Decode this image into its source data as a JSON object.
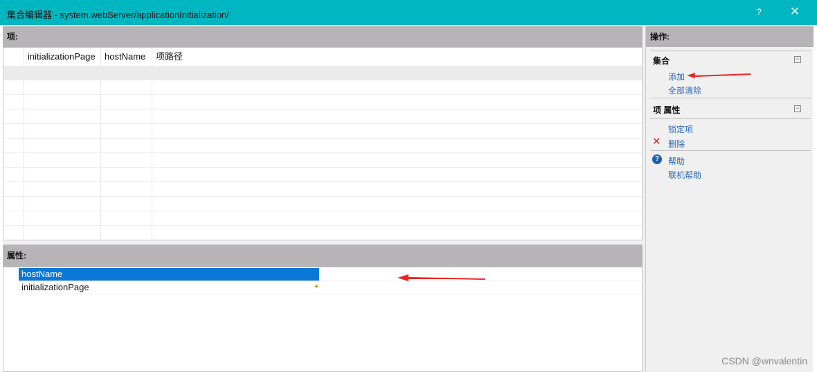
{
  "window": {
    "title": "集合编辑器 - system.webServer/applicationInitialization/",
    "help_label": "?",
    "close_label": "✕"
  },
  "items_panel": {
    "header": "项:",
    "columns": [
      "initializationPage",
      "hostName",
      "项路径"
    ]
  },
  "properties_panel": {
    "header": "属性:",
    "rows": [
      {
        "name": "hostName",
        "selected": true
      },
      {
        "name": "initializationPage",
        "selected": false,
        "key_icon": "key-icon"
      }
    ]
  },
  "actions_pane": {
    "header": "操作:",
    "collection": {
      "title": "集合",
      "collapse": "⊟",
      "links": [
        "添加",
        "全部清除"
      ]
    },
    "item_properties": {
      "title": "项 属性",
      "collapse": "⊟",
      "lock_link": "锁定项",
      "delete_link": "删除",
      "help_link": "帮助",
      "online_help_link": "联机帮助"
    }
  },
  "watermark": "CSDN @wnvalentin",
  "colors": {
    "titlebar": "#00b6c1",
    "selection": "#0a78d7",
    "link": "#2a6ab8",
    "annotation_arrow": "#e8261f"
  }
}
